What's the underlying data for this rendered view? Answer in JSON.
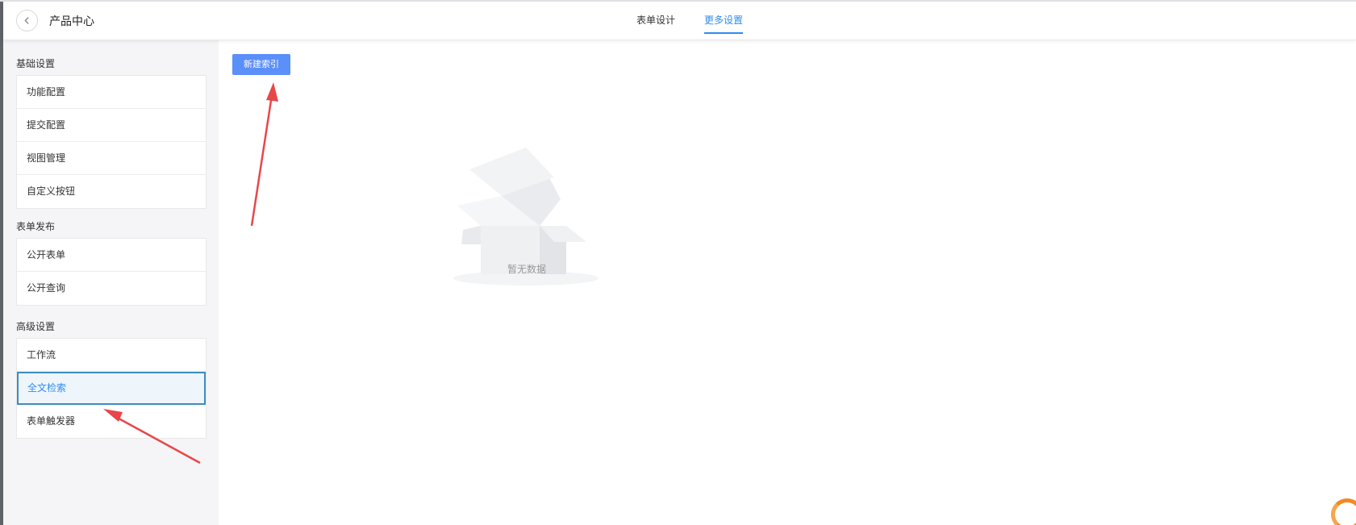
{
  "header": {
    "title": "产品中心",
    "tabs": [
      {
        "label": "表单设计",
        "active": false
      },
      {
        "label": "更多设置",
        "active": true
      }
    ]
  },
  "sidebar": {
    "groups": [
      {
        "title": "基础设置",
        "items": [
          "功能配置",
          "提交配置",
          "视图管理",
          "自定义按钮"
        ]
      },
      {
        "title": "表单发布",
        "items": [
          "公开表单",
          "公开查询"
        ]
      },
      {
        "title": "高级设置",
        "items": [
          "工作流",
          "全文检索",
          "表单触发器"
        ]
      }
    ],
    "active_item": "全文检索"
  },
  "main": {
    "new_index_button": "新建索引",
    "empty_text": "暂无数据"
  },
  "colors": {
    "accent": "#2d8cf0",
    "button": "#5b8ff9",
    "annotation_arrow": "#e8474a"
  },
  "icons": [
    "chevron-left-icon",
    "empty-box-icon",
    "annotation-arrow-icon"
  ]
}
